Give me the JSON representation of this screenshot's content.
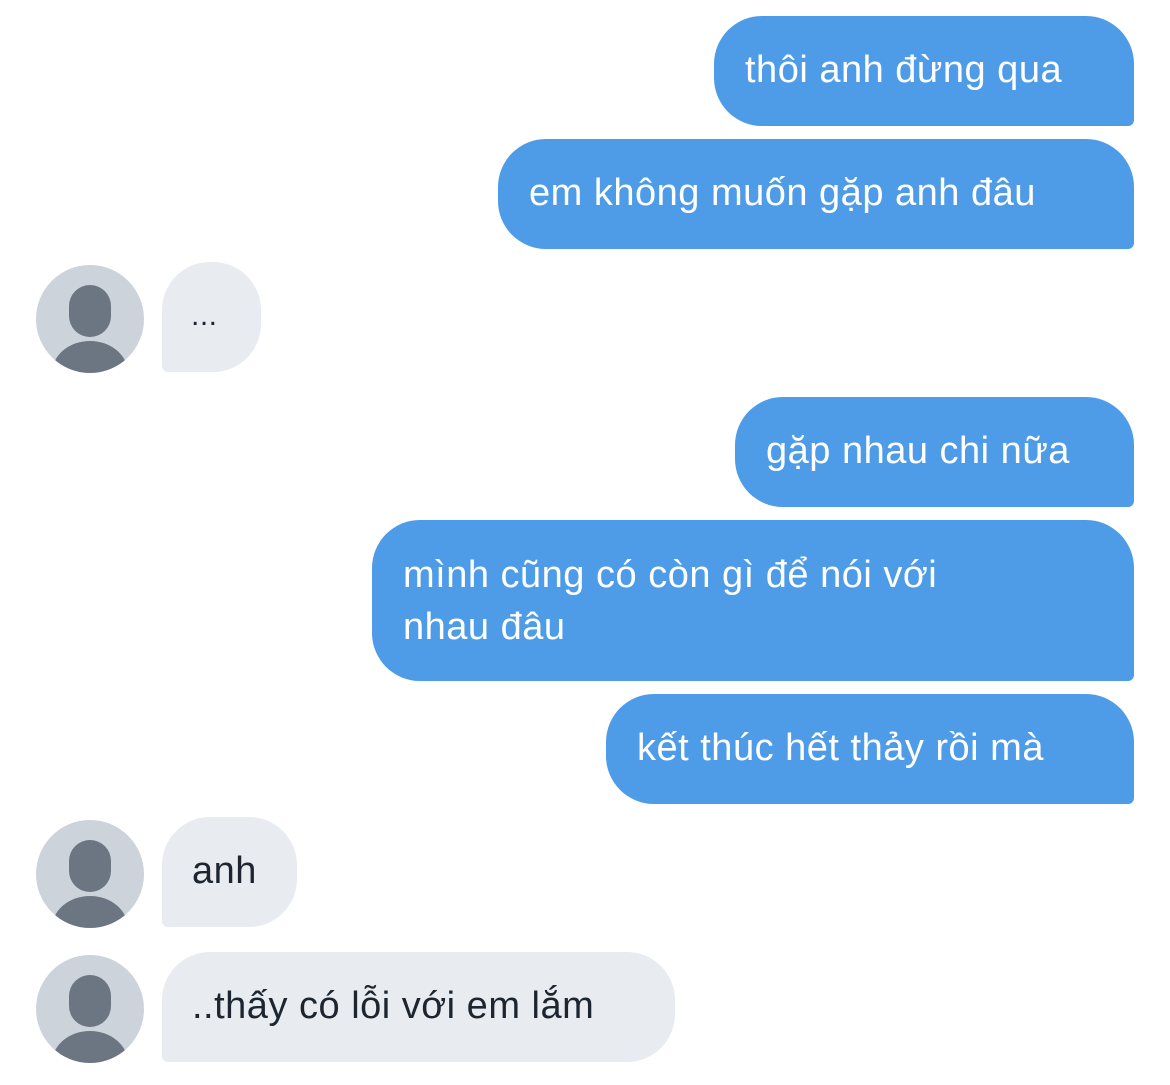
{
  "colors": {
    "sent_bubble": "#4e9ce8",
    "received_bubble": "#e8ebef",
    "avatar_bg": "#cdd3da",
    "avatar_figure": "#6b7682"
  },
  "messages": [
    {
      "from": "me",
      "text": "thôi anh đừng qua"
    },
    {
      "from": "me",
      "text": "em không muốn gặp anh đâu"
    },
    {
      "from": "them",
      "text": "..."
    },
    {
      "from": "me",
      "text": "gặp nhau chi nữa"
    },
    {
      "from": "me",
      "text": "mình cũng có còn gì để nói với\nnhau đâu"
    },
    {
      "from": "me",
      "text": "kết thúc hết thảy rồi mà"
    },
    {
      "from": "them",
      "text": "anh"
    },
    {
      "from": "them",
      "text": "..thấy có lỗi với em lắm"
    }
  ]
}
